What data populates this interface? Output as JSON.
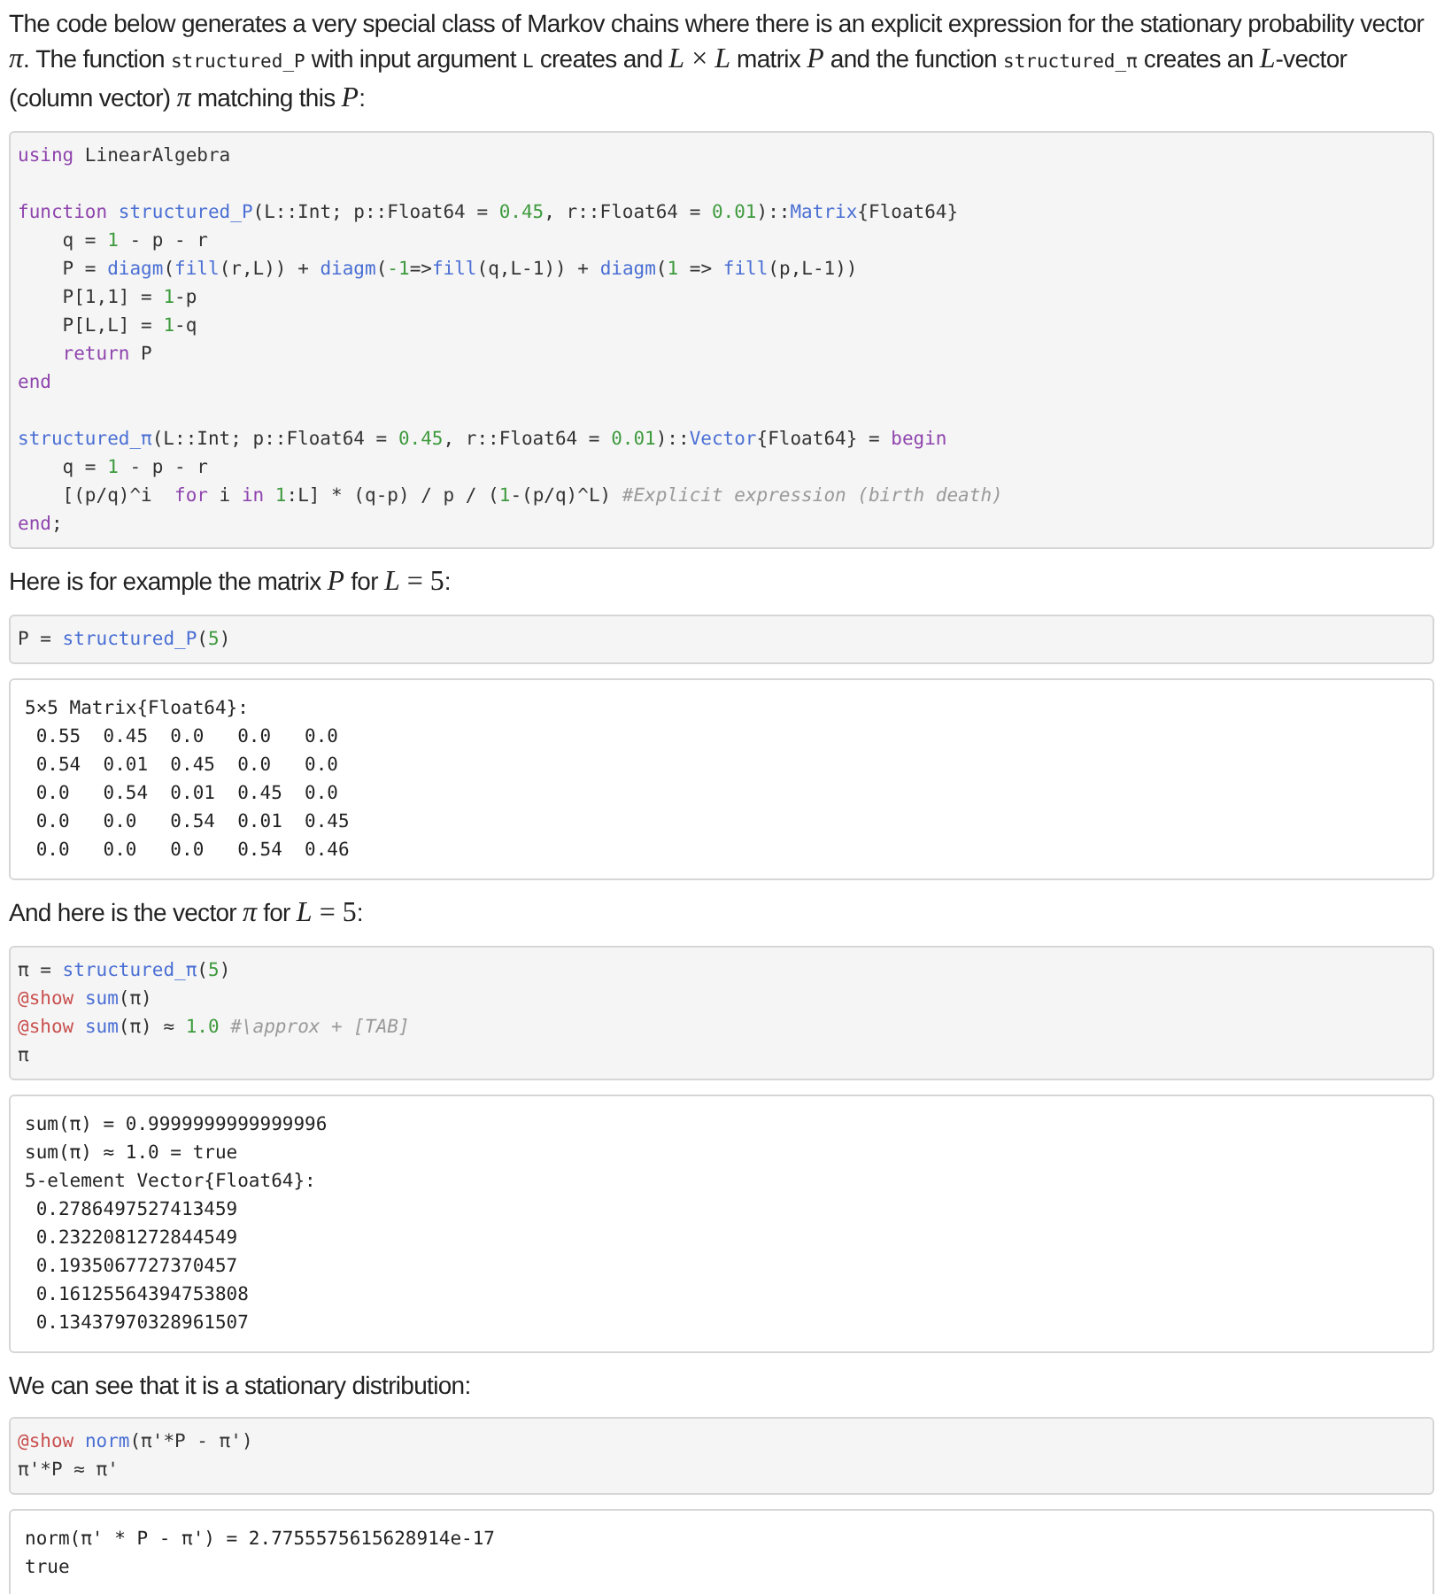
{
  "cells": [
    {
      "kind": "paragraph",
      "segments": [
        {
          "kind": "text",
          "text": "The code below generates a very special class of Markov chains where there is an explicit expression for the stationary probability vector "
        },
        {
          "kind": "math",
          "text": "*π*"
        },
        {
          "kind": "text",
          "text": ". The function "
        },
        {
          "kind": "code",
          "text": "structured_P"
        },
        {
          "kind": "text",
          "text": " with input argument "
        },
        {
          "kind": "code",
          "text": "L"
        },
        {
          "kind": "text",
          "text": " creates and "
        },
        {
          "kind": "math",
          "text": "*L* × *L*"
        },
        {
          "kind": "text",
          "text": " matrix "
        },
        {
          "kind": "math",
          "text": "*P*"
        },
        {
          "kind": "text",
          "text": " and the function "
        },
        {
          "kind": "code",
          "text": "structured_π"
        },
        {
          "kind": "text",
          "text": " creates an "
        },
        {
          "kind": "math",
          "text": "*L*"
        },
        {
          "kind": "text",
          "text": "-vector (column vector) "
        },
        {
          "kind": "math",
          "text": "*π*"
        },
        {
          "kind": "text",
          "text": " matching this "
        },
        {
          "kind": "math",
          "text": "*P*"
        },
        {
          "kind": "text",
          "text": ":"
        }
      ]
    },
    {
      "kind": "input",
      "groups": [
        [
          [
            {
              "kind": "keyword",
              "text": "using"
            },
            {
              "kind": "plain",
              "text": " LinearAlgebra"
            }
          ]
        ],
        [
          [
            {
              "kind": "keyword",
              "text": "function "
            },
            {
              "kind": "func",
              "text": "structured_P"
            },
            {
              "kind": "plain",
              "text": "(L::Int; p::Float64 = "
            },
            {
              "kind": "number",
              "text": "0.45"
            },
            {
              "kind": "plain",
              "text": ", r::Float64 = "
            },
            {
              "kind": "number",
              "text": "0.01"
            },
            {
              "kind": "plain",
              "text": ")::"
            },
            {
              "kind": "func",
              "text": "Matrix"
            },
            {
              "kind": "plain",
              "text": "{Float64}"
            }
          ],
          [
            {
              "kind": "plain",
              "text": "    q = "
            },
            {
              "kind": "number",
              "text": "1"
            },
            {
              "kind": "plain",
              "text": " - p - r"
            }
          ],
          [
            {
              "kind": "plain",
              "text": "    P = "
            },
            {
              "kind": "func",
              "text": "diagm"
            },
            {
              "kind": "plain",
              "text": "("
            },
            {
              "kind": "func",
              "text": "fill"
            },
            {
              "kind": "plain",
              "text": "(r,L)) + "
            },
            {
              "kind": "func",
              "text": "diagm"
            },
            {
              "kind": "plain",
              "text": "("
            },
            {
              "kind": "number",
              "text": "-1"
            },
            {
              "kind": "plain",
              "text": "=>"
            },
            {
              "kind": "func",
              "text": "fill"
            },
            {
              "kind": "plain",
              "text": "(q,L-1)) + "
            },
            {
              "kind": "func",
              "text": "diagm"
            },
            {
              "kind": "plain",
              "text": "("
            },
            {
              "kind": "number",
              "text": "1"
            },
            {
              "kind": "plain",
              "text": " => "
            },
            {
              "kind": "func",
              "text": "fill"
            },
            {
              "kind": "plain",
              "text": "(p,L-1))"
            }
          ],
          [
            {
              "kind": "plain",
              "text": "    P[1,1] = "
            },
            {
              "kind": "number",
              "text": "1"
            },
            {
              "kind": "plain",
              "text": "-p"
            }
          ],
          [
            {
              "kind": "plain",
              "text": "    P[L,L] = "
            },
            {
              "kind": "number",
              "text": "1"
            },
            {
              "kind": "plain",
              "text": "-q"
            }
          ],
          [
            {
              "kind": "keyword",
              "text": "    return"
            },
            {
              "kind": "plain",
              "text": " P"
            }
          ],
          [
            {
              "kind": "keyword",
              "text": "end"
            }
          ]
        ],
        [
          [
            {
              "kind": "func",
              "text": "structured_π"
            },
            {
              "kind": "plain",
              "text": "(L::Int; p::Float64 = "
            },
            {
              "kind": "number",
              "text": "0.45"
            },
            {
              "kind": "plain",
              "text": ", r::Float64 = "
            },
            {
              "kind": "number",
              "text": "0.01"
            },
            {
              "kind": "plain",
              "text": ")::"
            },
            {
              "kind": "func",
              "text": "Vector"
            },
            {
              "kind": "plain",
              "text": "{Float64} = "
            },
            {
              "kind": "keyword",
              "text": "begin"
            }
          ],
          [
            {
              "kind": "plain",
              "text": "    q = "
            },
            {
              "kind": "number",
              "text": "1"
            },
            {
              "kind": "plain",
              "text": " - p - r"
            }
          ],
          [
            {
              "kind": "plain",
              "text": "    [(p/q)^i  "
            },
            {
              "kind": "keyword",
              "text": "for"
            },
            {
              "kind": "plain",
              "text": " i "
            },
            {
              "kind": "keyword",
              "text": "in "
            },
            {
              "kind": "number",
              "text": "1"
            },
            {
              "kind": "plain",
              "text": ":L] * (q-p) / p / ("
            },
            {
              "kind": "number",
              "text": "1"
            },
            {
              "kind": "plain",
              "text": "-(p/q)^L) "
            },
            {
              "kind": "comment",
              "text": "#Explicit expression (birth death)"
            }
          ],
          [
            {
              "kind": "keyword",
              "text": "end"
            },
            {
              "kind": "plain",
              "text": ";"
            }
          ]
        ]
      ]
    },
    {
      "kind": "paragraph",
      "segments": [
        {
          "kind": "text",
          "text": "Here is for example the matrix "
        },
        {
          "kind": "math",
          "text": "*P*"
        },
        {
          "kind": "text",
          "text": " for "
        },
        {
          "kind": "math",
          "text": "*L* = 5"
        },
        {
          "kind": "text",
          "text": ":"
        }
      ]
    },
    {
      "kind": "input",
      "groups": [
        [
          [
            {
              "kind": "plain",
              "text": "P = "
            },
            {
              "kind": "func",
              "text": "structured_P"
            },
            {
              "kind": "plain",
              "text": "("
            },
            {
              "kind": "number",
              "text": "5"
            },
            {
              "kind": "plain",
              "text": ")"
            }
          ]
        ]
      ]
    },
    {
      "kind": "output",
      "lines": [
        "5×5 Matrix{Float64}:",
        " 0.55  0.45  0.0   0.0   0.0",
        " 0.54  0.01  0.45  0.0   0.0",
        " 0.0   0.54  0.01  0.45  0.0",
        " 0.0   0.0   0.54  0.01  0.45",
        " 0.0   0.0   0.0   0.54  0.46"
      ]
    },
    {
      "kind": "paragraph",
      "segments": [
        {
          "kind": "text",
          "text": "And here is the vector "
        },
        {
          "kind": "math",
          "text": "*π*"
        },
        {
          "kind": "text",
          "text": " for "
        },
        {
          "kind": "math",
          "text": "*L* = 5"
        },
        {
          "kind": "text",
          "text": ":"
        }
      ]
    },
    {
      "kind": "input",
      "groups": [
        [
          [
            {
              "kind": "plain",
              "text": "π = "
            },
            {
              "kind": "func",
              "text": "structured_π"
            },
            {
              "kind": "plain",
              "text": "("
            },
            {
              "kind": "number",
              "text": "5"
            },
            {
              "kind": "plain",
              "text": ")"
            }
          ],
          [
            {
              "kind": "macro",
              "text": "@show "
            },
            {
              "kind": "func",
              "text": "sum"
            },
            {
              "kind": "plain",
              "text": "(π)"
            }
          ],
          [
            {
              "kind": "macro",
              "text": "@show "
            },
            {
              "kind": "func",
              "text": "sum"
            },
            {
              "kind": "plain",
              "text": "(π) ≈ "
            },
            {
              "kind": "number",
              "text": "1.0"
            },
            {
              "kind": "comment",
              "text": " #\\approx + [TAB]"
            }
          ],
          [
            {
              "kind": "plain",
              "text": "π"
            }
          ]
        ]
      ]
    },
    {
      "kind": "output",
      "lines": [
        "sum(π) = 0.9999999999999996",
        "sum(π) ≈ 1.0 = true",
        "5-element Vector{Float64}:",
        " 0.2786497527413459",
        " 0.2322081272844549",
        " 0.1935067727370457",
        " 0.16125564394753808",
        " 0.13437970328961507"
      ]
    },
    {
      "kind": "paragraph",
      "segments": [
        {
          "kind": "text",
          "text": "We can see that it is a stationary distribution:"
        }
      ]
    },
    {
      "kind": "input",
      "groups": [
        [
          [
            {
              "kind": "macro",
              "text": "@show "
            },
            {
              "kind": "func",
              "text": "norm"
            },
            {
              "kind": "plain",
              "text": "(π'*P - π')"
            }
          ],
          [
            {
              "kind": "plain",
              "text": "π'*P ≈ π'"
            }
          ]
        ]
      ]
    },
    {
      "kind": "output",
      "lines": [
        "norm(π' * P - π') = 2.7755575615628914e-17",
        "true"
      ]
    }
  ]
}
